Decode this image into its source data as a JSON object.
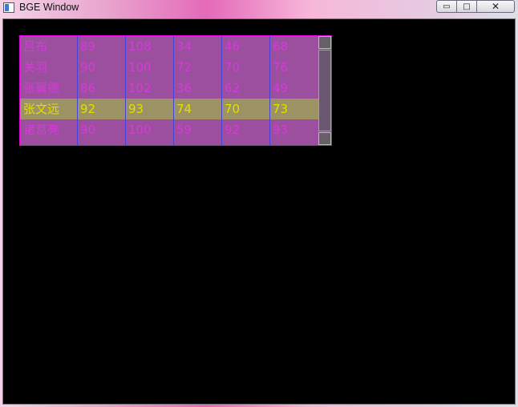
{
  "window": {
    "title": "BGE Window",
    "controls": {
      "minimize": "▭",
      "maximize": "□",
      "close": "✕"
    }
  },
  "table": {
    "rows": [
      {
        "cells": [
          "吕布",
          "89",
          "108",
          "34",
          "46",
          "68"
        ],
        "selected": false
      },
      {
        "cells": [
          "关羽",
          "90",
          "100",
          "72",
          "70",
          "76"
        ],
        "selected": false
      },
      {
        "cells": [
          "张翼德",
          "86",
          "102",
          "36",
          "62",
          "49"
        ],
        "selected": false
      },
      {
        "cells": [
          "张文远",
          "92",
          "93",
          "74",
          "70",
          "73"
        ],
        "selected": true
      },
      {
        "cells": [
          "诸葛亮",
          "90",
          "100",
          "59",
          "92",
          "93"
        ],
        "selected": false
      }
    ]
  },
  "colors": {
    "text_normal": "#d43cd6",
    "text_selected": "#e2e000",
    "row_bg": "#9b4f9e",
    "row_selected_bg": "#9c9263",
    "grid_line": "#4444d8",
    "border": "#e000e0"
  }
}
